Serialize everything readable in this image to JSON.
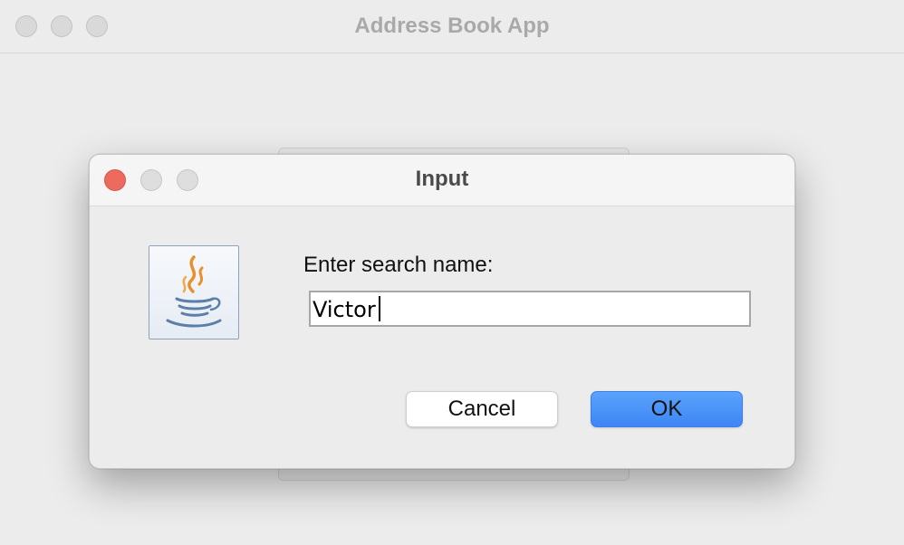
{
  "main_window": {
    "title": "Address Book App"
  },
  "dialog": {
    "title": "Input",
    "icon": "java-coffee-cup-icon",
    "prompt": "Enter search name:",
    "input_value": "Victor",
    "buttons": {
      "cancel_label": "Cancel",
      "ok_label": "OK"
    }
  },
  "colors": {
    "accent_blue": "#3d86f5",
    "close_red": "#ed6a5e",
    "window_bg": "#ececec"
  }
}
